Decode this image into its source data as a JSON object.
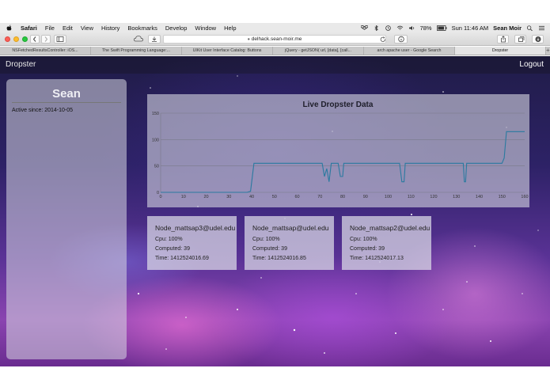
{
  "menubar": {
    "app": "Safari",
    "items": [
      "File",
      "Edit",
      "View",
      "History",
      "Bookmarks",
      "Develop",
      "Window",
      "Help"
    ],
    "battery": "78%",
    "clock": "Sun 11:46 AM",
    "user": "Sean Moir"
  },
  "browser": {
    "url": "delhack.sean-moir.me",
    "tabs": [
      {
        "label": "NSFetchedResultsController: iOS..."
      },
      {
        "label": "The Swift Programming Language:..."
      },
      {
        "label": "UIKit User Interface Catalog: Buttons"
      },
      {
        "label": "jQuery - getJSON( url, [data], [call..."
      },
      {
        "label": "arch apache user - Google Search"
      },
      {
        "label": "Dropster"
      }
    ],
    "new_tab": "+"
  },
  "nav": {
    "brand": "Dropster",
    "logout": "Logout"
  },
  "profile": {
    "name": "Sean",
    "active_since": "Active since: 2014-10-05"
  },
  "nodes": [
    {
      "name": "Node_mattsap3@udel.edu",
      "cpu": "Cpu: 100%",
      "computed": "Computed: 39",
      "time": "Time: 1412524016.69"
    },
    {
      "name": "Node_mattsap@udel.edu",
      "cpu": "Cpu: 100%",
      "computed": "Computed: 39",
      "time": "Time: 1412524016.85"
    },
    {
      "name": "Node_mattsap2@udel.edu",
      "cpu": "Cpu: 100%",
      "computed": "Computed: 39",
      "time": "Time: 1412524017.13"
    }
  ],
  "colors": {
    "line": "#2a7aa0",
    "accent": "#e8e8f0"
  },
  "chart_data": {
    "type": "line",
    "title": "Live Dropster Data",
    "xlabel": "",
    "ylabel": "",
    "xlim": [
      0,
      160
    ],
    "ylim": [
      0,
      150
    ],
    "xticks": [
      0,
      10,
      20,
      30,
      40,
      50,
      60,
      70,
      80,
      90,
      100,
      110,
      120,
      130,
      140,
      150,
      160
    ],
    "yticks": [
      0,
      50,
      100,
      150
    ],
    "grid": "horizontal",
    "series": [
      {
        "values": [
          {
            "x": 0,
            "y": 0
          },
          {
            "x": 38,
            "y": 0
          },
          {
            "x": 39.5,
            "y": 2
          },
          {
            "x": 41,
            "y": 55
          },
          {
            "x": 71,
            "y": 55
          },
          {
            "x": 72,
            "y": 30
          },
          {
            "x": 73,
            "y": 45
          },
          {
            "x": 74,
            "y": 20
          },
          {
            "x": 75,
            "y": 55
          },
          {
            "x": 78,
            "y": 55
          },
          {
            "x": 79,
            "y": 30
          },
          {
            "x": 80,
            "y": 30
          },
          {
            "x": 80.5,
            "y": 55
          },
          {
            "x": 105,
            "y": 55
          },
          {
            "x": 106,
            "y": 20
          },
          {
            "x": 107,
            "y": 20
          },
          {
            "x": 107.5,
            "y": 55
          },
          {
            "x": 133,
            "y": 55
          },
          {
            "x": 133.5,
            "y": 20
          },
          {
            "x": 134,
            "y": 20
          },
          {
            "x": 134.5,
            "y": 55
          },
          {
            "x": 150,
            "y": 55
          },
          {
            "x": 151,
            "y": 65
          },
          {
            "x": 152,
            "y": 115
          },
          {
            "x": 160,
            "y": 115
          }
        ]
      }
    ]
  }
}
